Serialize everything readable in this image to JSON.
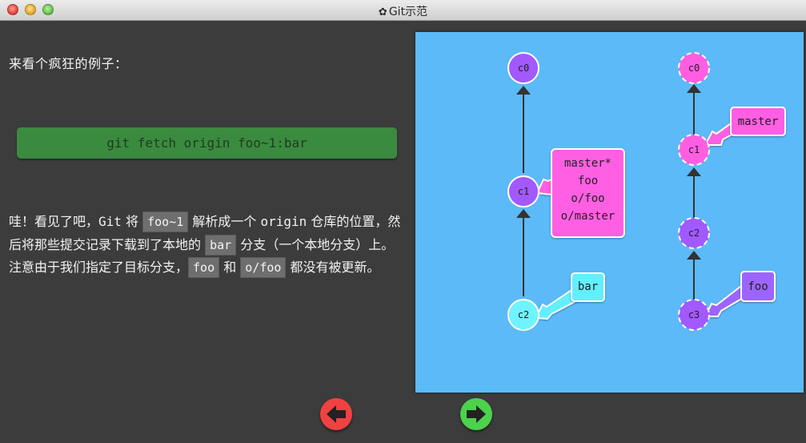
{
  "window": {
    "title": "Git示范"
  },
  "lesson": {
    "intro": "来看个疯狂的例子：",
    "command": "git fetch origin foo~1:bar",
    "para": {
      "t1": "哇！看见了吧，",
      "t2": "Git",
      "t3": " 将 ",
      "c1": "foo~1",
      "t4": " 解析成一个 ",
      "t5": "origin",
      "t6": " 仓库的位置，然后将那些提交记录下载到了本地的 ",
      "c2": "bar",
      "t7": " 分支（一个本地分支）上。注意由于我们指定了目标分支，",
      "c3": "foo",
      "t8": " 和 ",
      "c4": "o/foo",
      "t9": " 都没有被更新。"
    }
  },
  "local_repo": {
    "commits": [
      "c0",
      "c1",
      "c2"
    ],
    "branch_box": {
      "lines": [
        "master*",
        "foo",
        "o/foo",
        "o/master"
      ]
    },
    "bar_label": "bar"
  },
  "remote_repo": {
    "commits": [
      "c0",
      "c1",
      "c2",
      "c3"
    ],
    "master_label": "master",
    "foo_label": "foo"
  },
  "nav": {
    "prev_icon": "arrow-left-icon",
    "next_icon": "arrow-right-icon"
  },
  "colors": {
    "background": "#3c3c3c",
    "command_box": "#3a8a3f",
    "visualization_bg": "#5cbaf8",
    "commit_purple": "#a259ff",
    "commit_cyan": "#6ef3ff",
    "branch_pink": "#ff5ee3",
    "branch_cyan": "#62efff",
    "branch_purple": "#9c65ff",
    "prev_button": "#f24141",
    "next_button": "#4cd24c"
  }
}
